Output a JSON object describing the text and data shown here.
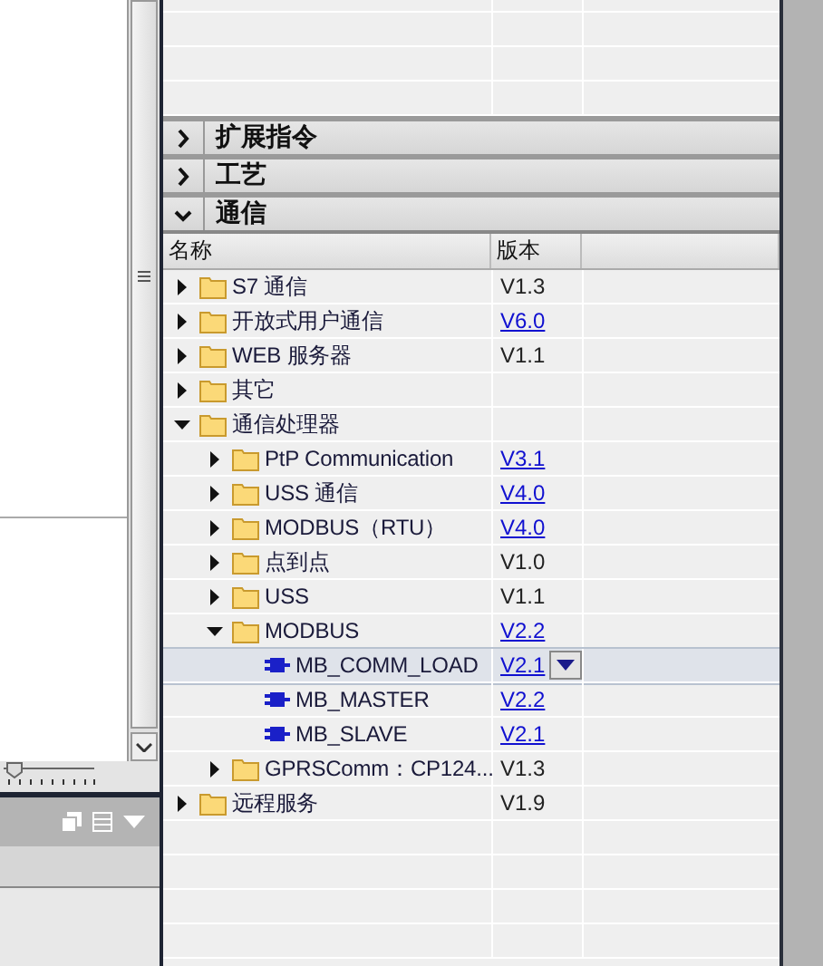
{
  "zoom": {
    "level": 0.12
  },
  "sections": [
    {
      "label": "扩展指令",
      "expanded": false
    },
    {
      "label": "工艺",
      "expanded": false
    },
    {
      "label": "通信",
      "expanded": true
    }
  ],
  "table": {
    "columns": [
      "名称",
      "版本"
    ],
    "rows": [
      {
        "kind": "folder",
        "name": "S7 通信",
        "version": "V1.3",
        "linked": false,
        "expanded": false,
        "selected": false
      },
      {
        "kind": "folder",
        "name": "开放式用户通信",
        "version": "V6.0",
        "linked": true,
        "expanded": false,
        "selected": false
      },
      {
        "kind": "folder",
        "name": "WEB 服务器",
        "version": "V1.1",
        "linked": false,
        "expanded": false,
        "selected": false
      },
      {
        "kind": "folder",
        "name": "其它",
        "expanded": false,
        "selected": false
      },
      {
        "kind": "folder",
        "name": "通信处理器",
        "expanded": true,
        "selected": false,
        "children": [
          {
            "kind": "folder",
            "name": "PtP Communication",
            "version": "V3.1",
            "linked": true,
            "expanded": false,
            "selected": false
          },
          {
            "kind": "folder",
            "name": "USS 通信",
            "version": "V4.0",
            "linked": true,
            "expanded": false,
            "selected": false
          },
          {
            "kind": "folder",
            "name": "MODBUS（RTU）",
            "version": "V4.0",
            "linked": true,
            "expanded": false,
            "selected": false
          },
          {
            "kind": "folder",
            "name": "点到点",
            "version": "V1.0",
            "linked": false,
            "expanded": false,
            "selected": false
          },
          {
            "kind": "folder",
            "name": "USS",
            "version": "V1.1",
            "linked": false,
            "expanded": false,
            "selected": false
          },
          {
            "kind": "folder",
            "name": "MODBUS",
            "version": "V2.2",
            "linked": true,
            "expanded": true,
            "selected": false,
            "children": [
              {
                "kind": "block",
                "name": "MB_COMM_LOAD",
                "version": "V2.1",
                "linked": true,
                "selected": true
              },
              {
                "kind": "block",
                "name": "MB_MASTER",
                "version": "V2.2",
                "linked": true,
                "selected": false
              },
              {
                "kind": "block",
                "name": "MB_SLAVE",
                "version": "V2.1",
                "linked": true,
                "selected": false
              }
            ]
          },
          {
            "kind": "folder",
            "name": "GPRSComm：CP124...",
            "version": "V1.3",
            "linked": false,
            "expanded": false,
            "selected": false
          }
        ]
      },
      {
        "kind": "folder",
        "name": "远程服务",
        "version": "V1.9",
        "linked": false,
        "expanded": false,
        "selected": false
      }
    ]
  }
}
